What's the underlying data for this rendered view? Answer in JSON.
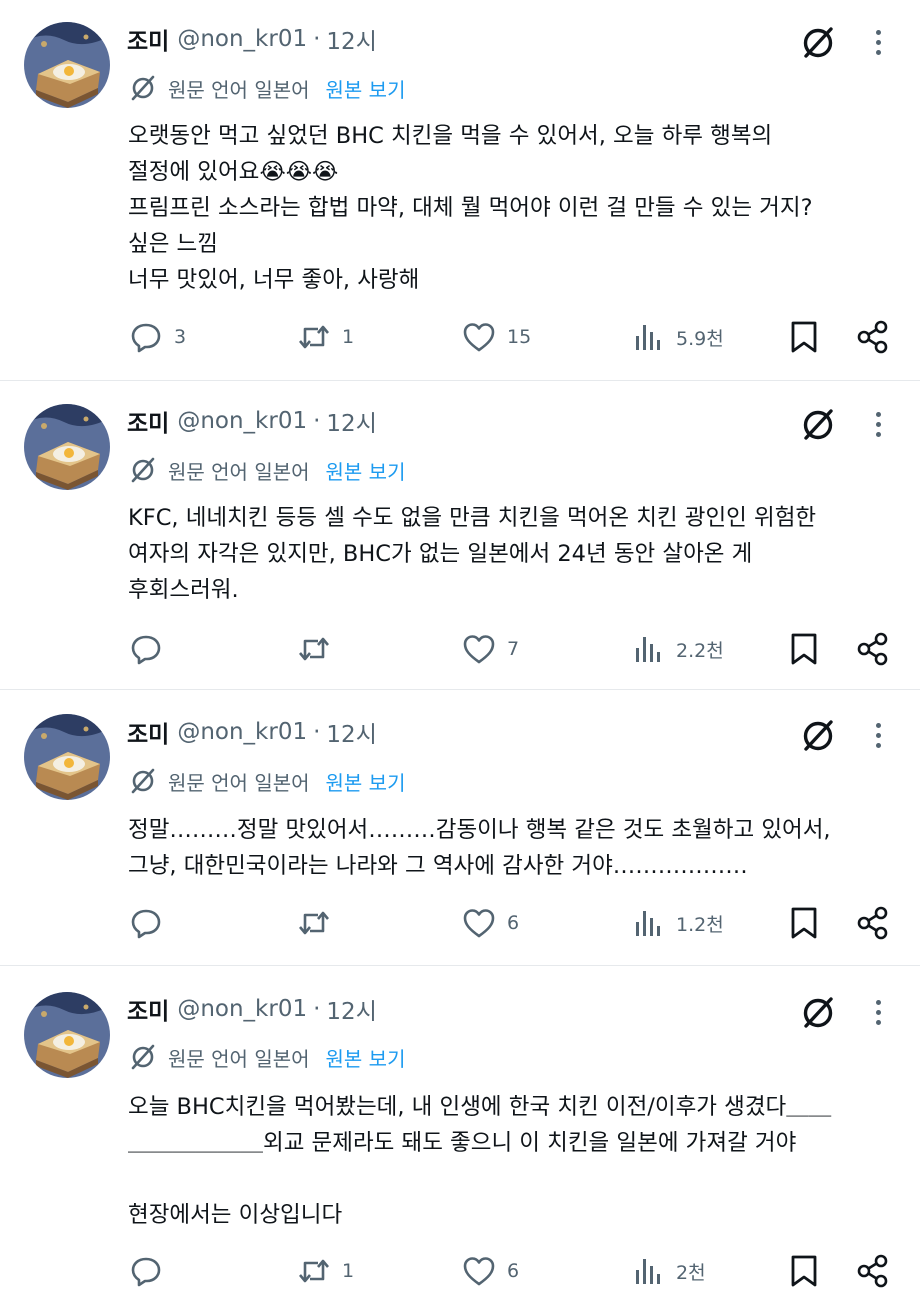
{
  "posts": [
    {
      "author": "조미",
      "handle": "@non_kr01",
      "separator": "·",
      "time": "12시",
      "translation_note": "원문 언어 일본어",
      "show_original": "원본 보기",
      "text": "오랫동안 먹고 싶었던 BHC 치킨을 먹을 수 있어서, 오늘 하루 행복의\n절정에 있어요😭😭😭\n프림프린 소스라는 합법 마약, 대체 뭘 먹어야 이런 걸 만들 수 있는 거지?\n싶은 느낌\n너무 맛있어, 너무 좋아, 사랑해",
      "replies": "3",
      "reposts": "1",
      "likes": "15",
      "views": "5.9천"
    },
    {
      "author": "조미",
      "handle": "@non_kr01",
      "separator": "·",
      "time": "12시",
      "translation_note": "원문 언어 일본어",
      "show_original": "원본 보기",
      "text": "KFC, 네네치킨 등등 셀 수도 없을 만큼 치킨을 먹어온 치킨 광인인 위험한\n여자의 자각은 있지만, BHC가 없는 일본에서 24년 동안 살아온 게\n후회스러워.",
      "replies": "",
      "reposts": "",
      "likes": "7",
      "views": "2.2천"
    },
    {
      "author": "조미",
      "handle": "@non_kr01",
      "separator": "·",
      "time": "12시",
      "translation_note": "원문 언어 일본어",
      "show_original": "원본 보기",
      "text": "정말………정말 맛있어서………감동이나 행복 같은 것도 초월하고 있어서,\n그냥, 대한민국이라는 나라와 그 역사에 감사한 거야………………",
      "replies": "",
      "reposts": "",
      "likes": "6",
      "views": "1.2천"
    },
    {
      "author": "조미",
      "handle": "@non_kr01",
      "separator": "·",
      "time": "12시",
      "translation_note": "원문 언어 일본어",
      "show_original": "원본 보기",
      "text": "오늘 BHC치킨을 먹어봤는데, 내 인생에 한국 치킨 이전/이후가 생겼다＿＿\n＿＿＿＿＿＿외교 문제라도 돼도 좋으니 이 치킨을 일본에 가져갈 거야\n\n현장에서는 이상입니다",
      "replies": "",
      "reposts": "1",
      "likes": "6",
      "views": "2천"
    }
  ],
  "icons": {
    "reply": "reply-icon",
    "repost": "repost-icon",
    "like": "heart-icon",
    "views": "views-icon",
    "bookmark": "bookmark-icon",
    "share": "share-icon",
    "grok": "grok-icon",
    "more": "more-icon",
    "translate": "translate-icon"
  },
  "colors": {
    "text": "#0f1419",
    "muted": "#536471",
    "link": "#1d9bf0",
    "divider": "#e6e9ec"
  }
}
